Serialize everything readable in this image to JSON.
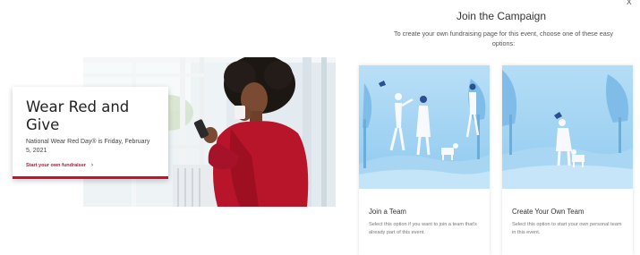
{
  "close": {
    "symbol": "x"
  },
  "hero": {
    "title": "Wear Red and Give",
    "subtitle": "National Wear Red Day® is Friday, February 5, 2021",
    "link_label": "Start your own fundraiser",
    "link_arrow": "›",
    "accent_color": "#c8102e"
  },
  "campaign": {
    "title": "Join the Campaign",
    "subtitle": "To create your own fundraising page for this event, choose one of these easy options:"
  },
  "options": [
    {
      "title": "Join a Team",
      "description": "Select this option if you want to join a team that's already part of this event.",
      "icon": "team-illustration"
    },
    {
      "title": "Create Your Own Team",
      "description": "Select this option to start your own personal team in this event.",
      "icon": "person-with-dog-illustration"
    }
  ]
}
